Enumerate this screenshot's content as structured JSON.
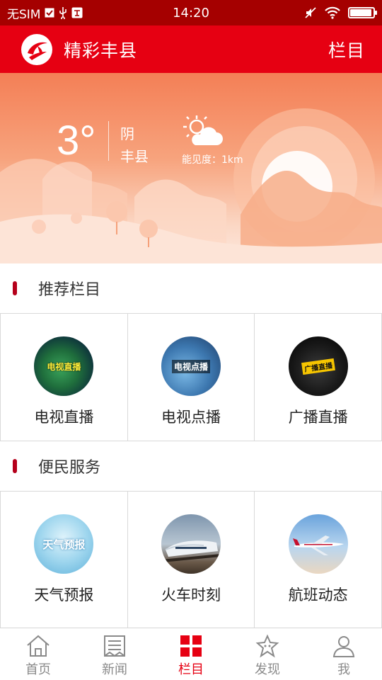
{
  "status_bar": {
    "carrier": "无SIM",
    "time": "14:20",
    "battery_level": 0.95
  },
  "header": {
    "title": "精彩丰县",
    "right_label": "栏目"
  },
  "weather": {
    "temperature": "3°",
    "condition": "阴",
    "location": "丰县",
    "visibility": "能见度：1km",
    "icon": "cloudy-sun-icon"
  },
  "sections": [
    {
      "title": "推荐栏目",
      "items": [
        {
          "label": "电视直播",
          "icon": "tv-live-icon",
          "icon_text": "电视直播"
        },
        {
          "label": "电视点播",
          "icon": "tv-vod-icon",
          "icon_text": "电视点播"
        },
        {
          "label": "广播直播",
          "icon": "radio-live-icon",
          "icon_text": "广播直播"
        }
      ]
    },
    {
      "title": "便民服务",
      "items": [
        {
          "label": "天气预报",
          "icon": "weather-forecast-icon",
          "icon_text": "天气预报"
        },
        {
          "label": "火车时刻",
          "icon": "train-schedule-icon",
          "icon_text": ""
        },
        {
          "label": "航班动态",
          "icon": "flight-status-icon",
          "icon_text": ""
        }
      ]
    }
  ],
  "tab_bar": {
    "items": [
      {
        "label": "首页",
        "icon": "home-icon"
      },
      {
        "label": "新闻",
        "icon": "news-icon"
      },
      {
        "label": "栏目",
        "icon": "grid-icon"
      },
      {
        "label": "发现",
        "icon": "discover-icon"
      },
      {
        "label": "我",
        "icon": "user-icon"
      }
    ],
    "active_index": 2
  },
  "colors": {
    "status_bar": "#a50000",
    "header": "#e60012",
    "section_marker": "#b5001b",
    "tab_active": "#e60012",
    "tab_inactive": "#8a8a8a"
  }
}
